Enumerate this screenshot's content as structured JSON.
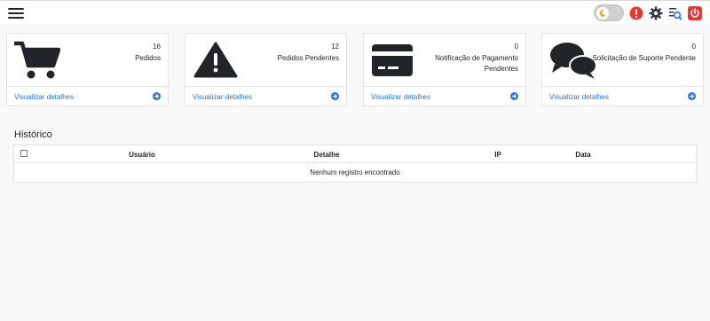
{
  "icons": {
    "menu": "hamburger-menu-icon",
    "theme": "moon-icon",
    "alert": "exclamation-circle-icon",
    "settings": "gear-icon",
    "search": "search-list-icon",
    "power": "power-icon"
  },
  "colors": {
    "alert": "#e53935",
    "power": "#e53935",
    "search": "#1a73e8",
    "link": "#1a73e8",
    "moon": "#f5a623"
  },
  "cards": [
    {
      "count": "16",
      "label": "Pedidos",
      "link": "Visualizar detalhes",
      "icon": "shopping-cart-icon"
    },
    {
      "count": "12",
      "label": "Pedidos Pendentes",
      "link": "Visualizar detalhes",
      "icon": "warning-triangle-icon"
    },
    {
      "count": "0",
      "label": "Notificação de Pagamento Pendentes",
      "link": "Visualizar detalhes",
      "icon": "credit-card-icon"
    },
    {
      "count": "0",
      "label": "Solicitação de Suporte Pendente",
      "link": "Visualizar detalhes",
      "icon": "chat-bubbles-icon"
    }
  ],
  "history": {
    "title": "Histórico",
    "columns": [
      "Usuário",
      "Detalhe",
      "IP",
      "Data"
    ],
    "empty_message": "Nenhum registro encontrado"
  }
}
